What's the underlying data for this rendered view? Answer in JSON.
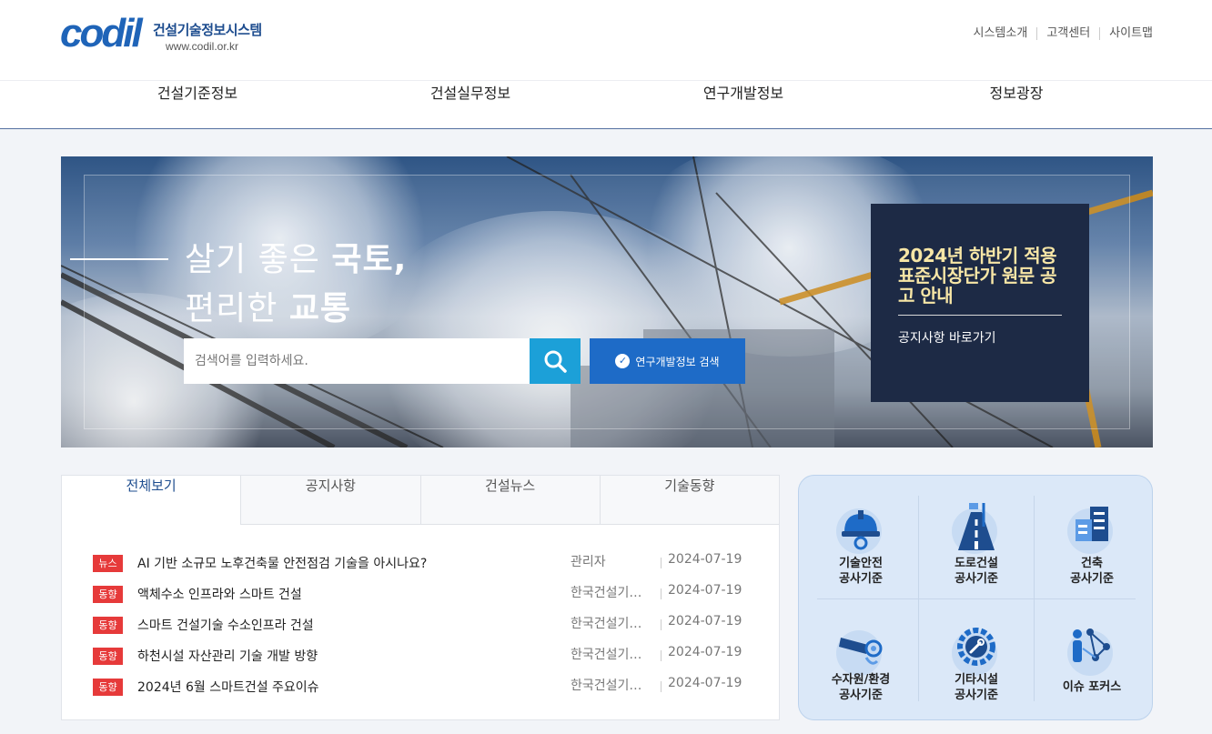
{
  "header": {
    "logo_mark": "codil",
    "logo_title": "건설기술정보시스템",
    "logo_url": "www.codil.or.kr",
    "util_links": [
      "시스템소개",
      "고객센터",
      "사이트맵"
    ]
  },
  "nav": {
    "items": [
      "건설기준정보",
      "건설실무정보",
      "연구개발정보",
      "정보광장"
    ]
  },
  "hero": {
    "slogan_line1_normal": "살기 좋은 ",
    "slogan_line1_bold": "국토,",
    "slogan_line2_normal": "편리한 ",
    "slogan_line2_bold": "교통",
    "search_placeholder": "검색어를 입력하세요.",
    "rnd_button_label": "연구개발정보 검색",
    "notice_title": "2024년 하반기 적용 표준시장단가 원문 공고 안내",
    "notice_link": "공지사항 바로가기"
  },
  "board": {
    "tabs": [
      "전체보기",
      "공지사항",
      "건설뉴스",
      "기술동향"
    ],
    "active_tab": "전체보기",
    "rows": [
      {
        "badge": "뉴스",
        "title": "AI 기반 소규모 노후건축물 안전점검 기술을 아시나요?",
        "author": "관리자",
        "date": "2024-07-19"
      },
      {
        "badge": "동향",
        "title": "액체수소 인프라와 스마트 건설",
        "author": "한국건설기…",
        "date": "2024-07-19"
      },
      {
        "badge": "동향",
        "title": "스마트 건설기술 수소인프라 건설",
        "author": "한국건설기…",
        "date": "2024-07-19"
      },
      {
        "badge": "동향",
        "title": "하천시설 자산관리 기술 개발 방향",
        "author": "한국건설기…",
        "date": "2024-07-19"
      },
      {
        "badge": "동향",
        "title": "2024년 6월 스마트건설 주요이슈",
        "author": "한국건설기…",
        "date": "2024-07-19"
      }
    ]
  },
  "quick_menu": {
    "items": [
      {
        "line1": "기술안전",
        "line2": "공사기준",
        "icon": "safety-helmet-icon"
      },
      {
        "line1": "도로건설",
        "line2": "공사기준",
        "icon": "road-icon"
      },
      {
        "line1": "건축",
        "line2": "공사기준",
        "icon": "building-icon"
      },
      {
        "line1": "수자원/환경",
        "line2": "공사기준",
        "icon": "water-pipe-icon"
      },
      {
        "line1": "기타시설",
        "line2": "공사기준",
        "icon": "gear-wrench-icon"
      },
      {
        "line1": "이슈 포커스",
        "line2": "",
        "icon": "network-person-icon"
      }
    ]
  },
  "colors": {
    "brand_blue": "#1e4d8f",
    "search_button": "#1ca0d8",
    "rnd_button": "#1e6bc7",
    "badge_red": "#e63a3a",
    "notice_bg": "#1d2a45",
    "notice_text": "#f7e6a6"
  }
}
